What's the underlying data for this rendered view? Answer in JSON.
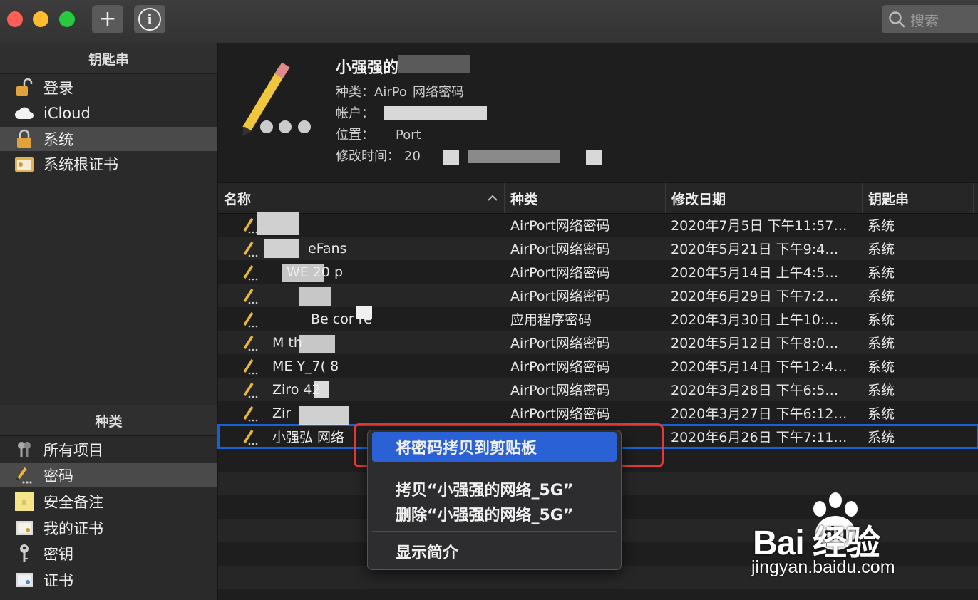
{
  "colors": {
    "accent": "#2a62d5",
    "close": "#ff5f57",
    "minimize": "#febc2e",
    "zoom": "#28c840",
    "highlight_box": "#e23a36"
  },
  "toolbar": {
    "add_icon": "+",
    "info_icon": "i",
    "search_placeholder": "搜索"
  },
  "sidebar": {
    "keychains_header": "钥匙串",
    "keychains": [
      {
        "label": "登录",
        "icon": "lock-open-icon"
      },
      {
        "label": "iCloud",
        "icon": "cloud-icon"
      },
      {
        "label": "系统",
        "icon": "lock-icon",
        "selected": true
      },
      {
        "label": "系统根证书",
        "icon": "certificate-folder-icon"
      }
    ],
    "category_header": "种类",
    "categories": [
      {
        "label": "所有项目",
        "icon": "keys-icon"
      },
      {
        "label": "密码",
        "icon": "pencil-icon",
        "selected": true
      },
      {
        "label": "安全备注",
        "icon": "note-icon"
      },
      {
        "label": "我的证书",
        "icon": "my-certificate-icon"
      },
      {
        "label": "密钥",
        "icon": "key-icon"
      },
      {
        "label": "证书",
        "icon": "certificate-icon"
      }
    ]
  },
  "detail": {
    "title": "小强强的",
    "kind_label": "种类：",
    "kind_value": "AirPo",
    "kind_value_suffix": "网络密码",
    "account_label": "帐户：",
    "where_label": "位置：",
    "where_value": "Port",
    "modified_label": "修改时间：",
    "modified_value": "20"
  },
  "table": {
    "columns": [
      {
        "label": "名称",
        "sort": "ascending"
      },
      {
        "label": "种类"
      },
      {
        "label": "修改日期"
      },
      {
        "label": "钥匙串"
      }
    ],
    "rows": [
      {
        "name": "",
        "kind": "AirPort网络密码",
        "date": "2020年7月5日 下午11:57…",
        "keychain": "系统"
      },
      {
        "name": "eFans",
        "kind": "AirPort网络密码",
        "date": "2020年5月21日 下午9:4…",
        "keychain": "系统"
      },
      {
        "name": "WE  20  p",
        "kind": "AirPort网络密码",
        "date": "2020年5月14日 上午4:5…",
        "keychain": "系统"
      },
      {
        "name": "",
        "kind": "AirPort网络密码",
        "date": "2020年6月29日 下午7:2…",
        "keychain": "系统"
      },
      {
        "name": "Be  cor     re",
        "kind": "应用程序密码",
        "date": "2020年3月30日 上午10:…",
        "keychain": "系统"
      },
      {
        "name": "M      th",
        "kind": "AirPort网络密码",
        "date": "2020年5月12日 下午8:0…",
        "keychain": "系统"
      },
      {
        "name": "ME    Y_7(  8",
        "kind": "AirPort网络密码",
        "date": "2020年5月14日 下午12:4…",
        "keychain": "系统"
      },
      {
        "name": "Ziro    42",
        "kind": "AirPort网络密码",
        "date": "2020年3月28日 下午6:5…",
        "keychain": "系统"
      },
      {
        "name": "Zir",
        "kind": "AirPort网络密码",
        "date": "2020年3月27日 下午6:12…",
        "keychain": "系统"
      },
      {
        "name": "小强弘 网络",
        "kind": "",
        "date": "2020年6月26日 下午7:11…",
        "keychain": "系统",
        "selected": true
      }
    ]
  },
  "context_menu": {
    "items": [
      {
        "label": "将密码拷贝到剪贴板",
        "highlighted": true
      },
      {
        "label": "拷贝“小强强的网络_5G”"
      },
      {
        "label": "删除“小强强的网络_5G”"
      },
      {
        "label": "显示简介"
      }
    ]
  },
  "watermark": {
    "brand": "Bai  经验",
    "site": "jingyan.baidu.com"
  }
}
